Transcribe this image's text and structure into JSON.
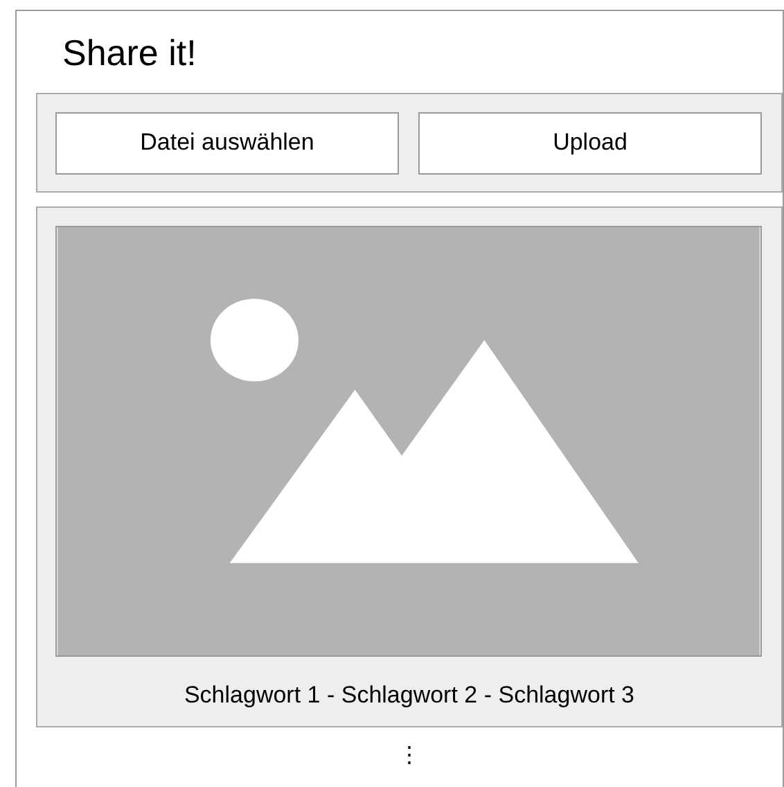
{
  "title": "Share it!",
  "buttons": [
    "Datei auswählen",
    "Upload"
  ],
  "image": {
    "kind": "picture",
    "caption": "Schlagwort 1 - Schlagwort 2 - Schlagwort 3"
  },
  "more": "⋮"
}
